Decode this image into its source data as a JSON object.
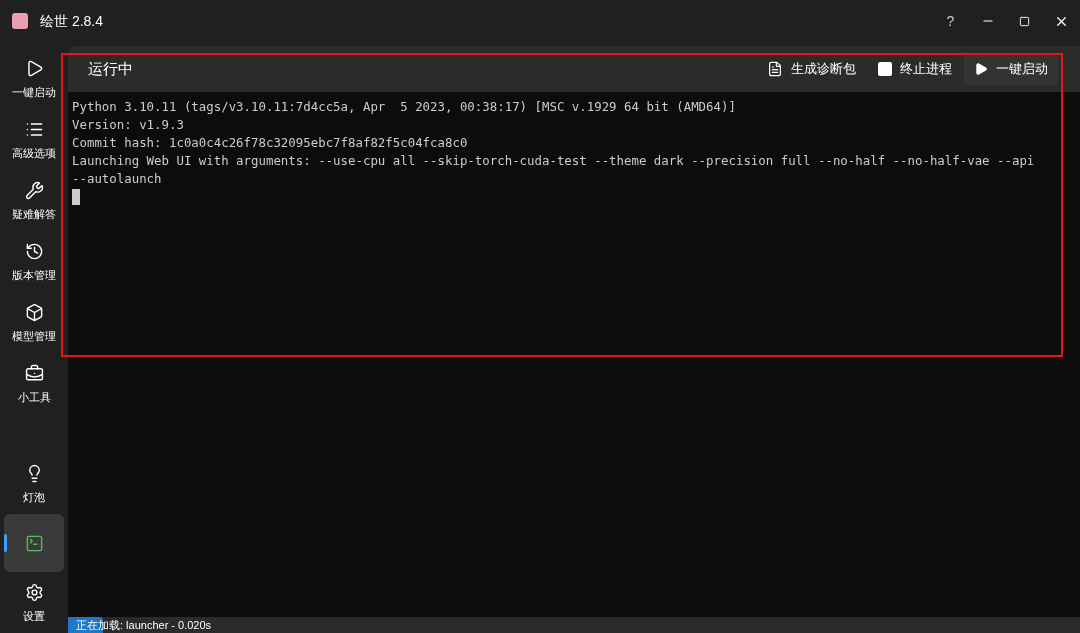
{
  "window": {
    "title": "绘世 2.8.4",
    "help": "?"
  },
  "sidebar": {
    "items": [
      {
        "label": "一键启动",
        "selected": false
      },
      {
        "label": "高级选项",
        "selected": false
      },
      {
        "label": "疑难解答",
        "selected": false
      },
      {
        "label": "版本管理",
        "selected": false
      },
      {
        "label": "模型管理",
        "selected": false
      },
      {
        "label": "小工具",
        "selected": false
      }
    ],
    "bottom_items": [
      {
        "label": "灯泡",
        "selected": false
      },
      {
        "selected": true
      },
      {
        "label": "设置",
        "selected": false
      }
    ]
  },
  "header": {
    "title": "运行中",
    "actions": [
      {
        "label": "生成诊断包"
      },
      {
        "label": "终止进程"
      },
      {
        "label": "一键启动"
      }
    ]
  },
  "console": {
    "lines": [
      "Python 3.10.11 (tags/v3.10.11:7d4cc5a, Apr  5 2023, 00:38:17) [MSC v.1929 64 bit (AMD64)]",
      "Version: v1.9.3",
      "Commit hash: 1c0a0c4c26f78c32095ebc7f8af82f5c04fca8c0",
      "Launching Web UI with arguments: --use-cpu all --skip-torch-cuda-test --theme dark --precision full --no-half --no-half-vae --api",
      "--autolaunch"
    ],
    "cursor": true
  },
  "status_bar": {
    "text": "正在加载: launcher - 0.020s",
    "level": 0.035
  }
}
